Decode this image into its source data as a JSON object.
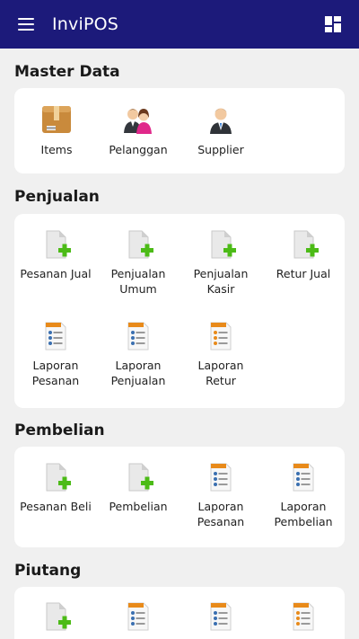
{
  "header": {
    "title": "InviPOS"
  },
  "sections": {
    "master": {
      "title": "Master Data",
      "items": [
        "Items",
        "Pelanggan",
        "Supplier"
      ]
    },
    "penjualan": {
      "title": "Penjualan",
      "items": [
        "Pesanan Jual",
        "Penjualan\nUmum",
        "Penjualan\nKasir",
        "Retur Jual",
        "Laporan\nPesanan",
        "Laporan\nPenjualan",
        "Laporan\nRetur"
      ]
    },
    "pembelian": {
      "title": "Pembelian",
      "items": [
        "Pesanan Beli",
        "Pembelian",
        "Laporan\nPesanan",
        "Laporan\nPembelian"
      ]
    },
    "piutang": {
      "title": "Piutang"
    }
  },
  "icons": {
    "menu": "hamburger-menu-icon",
    "dashboard": "dashboard-icon",
    "box": "box-icon",
    "customers": "customers-icon",
    "supplier": "supplier-icon",
    "doc_add": "document-add-icon",
    "report": "report-icon"
  },
  "colors": {
    "appbar": "#1c1a7a",
    "background": "#f0f0f0",
    "card": "#ffffff",
    "add_green": "#4cbb17",
    "report_orange": "#e88a1a"
  }
}
